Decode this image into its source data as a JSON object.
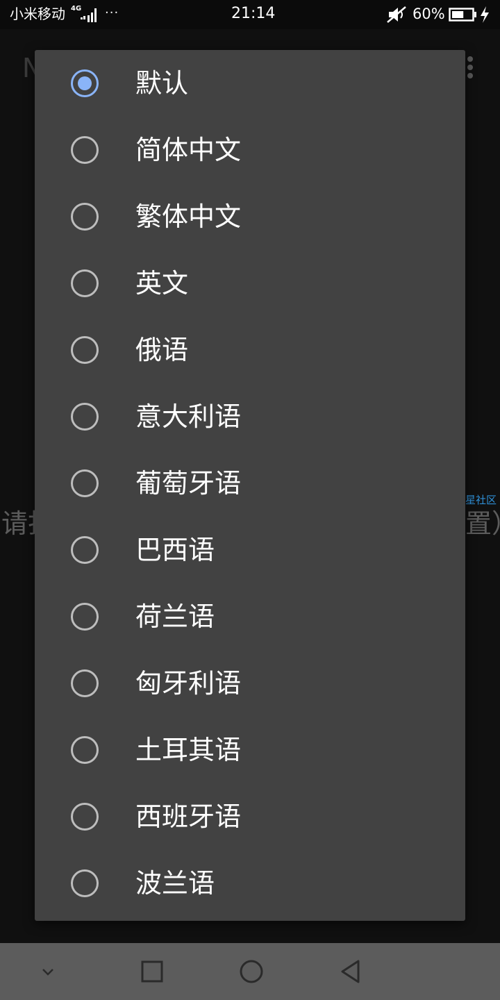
{
  "status_bar": {
    "carrier": "小米移动",
    "network": "4G",
    "more": "···",
    "time": "21:14",
    "battery_percent": "60%",
    "battery_level": 0.6
  },
  "background": {
    "title_fragment": "N",
    "left_text_fragment": "请打",
    "right_text_fragment": "置）",
    "watermark": "流星社区"
  },
  "dialog": {
    "options": [
      {
        "label": "默认",
        "checked": true
      },
      {
        "label": "简体中文",
        "checked": false
      },
      {
        "label": "繁体中文",
        "checked": false
      },
      {
        "label": "英文",
        "checked": false
      },
      {
        "label": "俄语",
        "checked": false
      },
      {
        "label": "意大利语",
        "checked": false
      },
      {
        "label": "葡萄牙语",
        "checked": false
      },
      {
        "label": "巴西语",
        "checked": false
      },
      {
        "label": "荷兰语",
        "checked": false
      },
      {
        "label": "匈牙利语",
        "checked": false
      },
      {
        "label": "土耳其语",
        "checked": false
      },
      {
        "label": "西班牙语",
        "checked": false
      },
      {
        "label": "波兰语",
        "checked": false
      }
    ]
  },
  "colors": {
    "dialog_bg": "#424242",
    "accent": "#8ab4f8",
    "radio_unchecked": "#bdbdbd",
    "nav_bar_bg": "#5c5c5c"
  }
}
